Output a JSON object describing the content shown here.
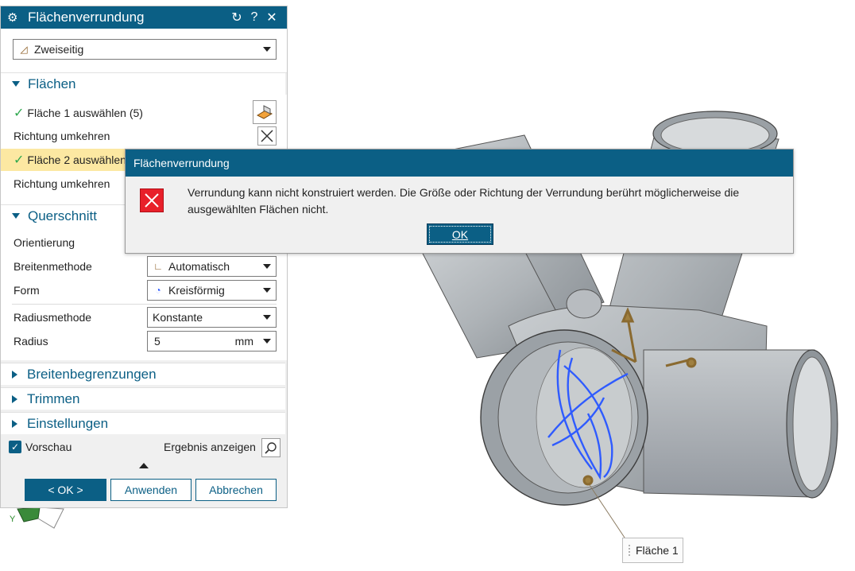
{
  "panel": {
    "title": "Flächenverrundung",
    "type_select": "Zweiseitig",
    "groups": {
      "flaechen": "Flächen",
      "querschnitt": "Querschnitt",
      "breitenbegrenzungen": "Breitenbegrenzungen",
      "trimmen": "Trimmen",
      "einstellungen": "Einstellungen"
    },
    "flaechen": {
      "face1_label": "Fläche 1 auswählen (5)",
      "reverse1_label": "Richtung umkehren",
      "face2_label": "Fläche 2 auswählen",
      "reverse2_label": "Richtung umkehren"
    },
    "querschnitt": {
      "orientierung_label": "Orientierung",
      "breitenmethode_label": "Breitenmethode",
      "breitenmethode_value": "Automatisch",
      "form_label": "Form",
      "form_value": "Kreisförmig",
      "radiusmethode_label": "Radiusmethode",
      "radiusmethode_value": "Konstante",
      "radius_label": "Radius",
      "radius_value": "5",
      "radius_unit": "mm"
    },
    "footer": {
      "preview_label": "Vorschau",
      "preview_checked": true,
      "result_label": "Ergebnis anzeigen",
      "ok_label": "< OK >",
      "apply_label": "Anwenden",
      "cancel_label": "Abbrechen"
    }
  },
  "modal": {
    "title": "Flächenverrundung",
    "message": "Verrundung kann nicht konstruiert werden. Die Größe oder Richtung der Verrundung berührt möglicherweise die ausgewählten Flächen nicht.",
    "ok_label": "OK"
  },
  "viewport": {
    "face_tag": "Fläche 1",
    "axis_y": "Y"
  },
  "colors": {
    "accent": "#0b5f85",
    "highlight": "#fce8a2",
    "error": "#e8202a",
    "selection_curves": "#2f5bff"
  }
}
